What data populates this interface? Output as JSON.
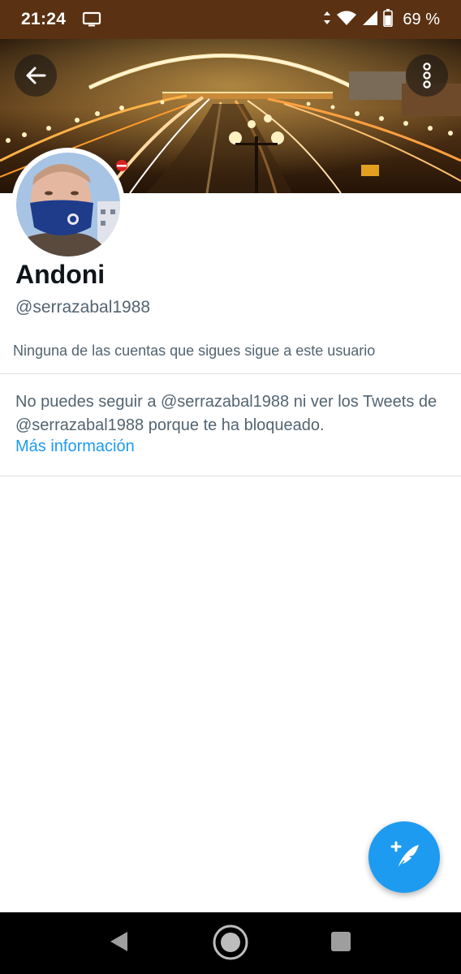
{
  "status_bar": {
    "time": "21:24",
    "battery_percent": "69 %",
    "icons": [
      "cast-icon",
      "data-arrows-icon",
      "wifi-icon",
      "signal-icon",
      "battery-icon"
    ]
  },
  "banner": {
    "back_icon": "arrow-left-icon",
    "more_icon": "more-vertical-icon"
  },
  "profile": {
    "display_name": "Andoni",
    "handle": "@serrazabal1988",
    "follow_context": "Ninguna de las cuentas que sigues sigue a este usuario"
  },
  "blocked": {
    "message": "No puedes seguir a @serrazabal1988 ni ver los Tweets de @serrazabal1988 porque te ha bloqueado.",
    "learn_more": "Más información"
  },
  "fab": {
    "icon": "compose-tweet-icon"
  },
  "nav_bar": {
    "icons": [
      "back-triangle-icon",
      "home-circle-icon",
      "recents-square-icon"
    ]
  },
  "colors": {
    "status_bar_bg": "#5a3213",
    "accent": "#1d9bf0",
    "secondary_text": "#536471",
    "primary_text": "#0f1419",
    "divider": "#dcdfe2"
  }
}
